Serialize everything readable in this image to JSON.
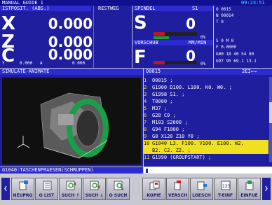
{
  "header": {
    "title": "MANUAL GUIDE i",
    "time": "09:23:51"
  },
  "position": {
    "title": "ISTPOSIT. (ABS.)",
    "restweg": "RESTWEG",
    "axes": [
      {
        "letter": "X",
        "value": "0.000"
      },
      {
        "letter": "Z",
        "value": "0.000"
      },
      {
        "letter": "C",
        "value": "0.000"
      }
    ],
    "y_label": "Y",
    "y_value": "0.000",
    "a_label": "A",
    "a_value": "0.000"
  },
  "spindle": {
    "title": "SPINDEL",
    "channel": "S1",
    "letter": "S",
    "value": "0",
    "percent": "0%",
    "load": 0.25
  },
  "feed": {
    "title": "VORSCHUB",
    "unit": "MM/MIN",
    "letter": "F",
    "value": "0",
    "percent": "0%",
    "load": 0.25
  },
  "modal": {
    "lines": [
      "O 0015",
      "N 00014",
      "T 0",
      "",
      "S      0 M 0",
      "F   0.0000",
      "G00 18 40 54 80",
      "G97 95 69.1 13.1"
    ]
  },
  "sim": {
    "title": "SIMULATE-ANIMATE"
  },
  "program": {
    "name": "O0015",
    "page": "2EI←→",
    "lines": [
      {
        "n": "1",
        "text": "O0015 ;"
      },
      {
        "n": "2",
        "text": "G1900 D100. L100. K0. W0. ;"
      },
      {
        "n": "3",
        "text": "G1998 S1. ;"
      },
      {
        "n": "4",
        "text": "T0000 ;"
      },
      {
        "n": "5",
        "text": "M37 ;"
      },
      {
        "n": "6",
        "text": "G28 C0 ;"
      },
      {
        "n": "7",
        "text": "M103 S2000 ;"
      },
      {
        "n": "8",
        "text": "G94 F1000 ;"
      },
      {
        "n": "9",
        "text": "G0 X120 Z10 Y0 ;"
      },
      {
        "n": "10",
        "text": "G1040 L3. F100. V100. E100. W2."
      },
      {
        "n": "",
        "text": "B2. C2. Z2. ;"
      },
      {
        "n": "11",
        "text": "G1990 (GROUPSTART) ;"
      }
    ]
  },
  "status": {
    "message": "G1040:TASCHENFRAESEN(SCHRUPPEN)"
  },
  "softkeys": [
    {
      "label": "NEUPRG",
      "icon": "new-program-icon"
    },
    {
      "label": "O LIST",
      "icon": "program-list-icon"
    },
    {
      "label": "SUCH ↑",
      "icon": "search-up-icon"
    },
    {
      "label": "SUCH ↓",
      "icon": "search-down-icon"
    },
    {
      "label": "O SUCH",
      "icon": "program-search-icon"
    },
    {
      "label": "KOPIE",
      "icon": "copy-icon"
    },
    {
      "label": "VERSCH",
      "icon": "move-icon"
    },
    {
      "label": "LOESCH",
      "icon": "delete-icon"
    },
    {
      "label": "T-EINF",
      "icon": "t-insert-icon"
    },
    {
      "label": "EINFUE",
      "icon": "insert-icon"
    }
  ],
  "colors": {
    "bg": "#1e1e9e",
    "highlight": "#f0e020",
    "panel": "#101010"
  }
}
